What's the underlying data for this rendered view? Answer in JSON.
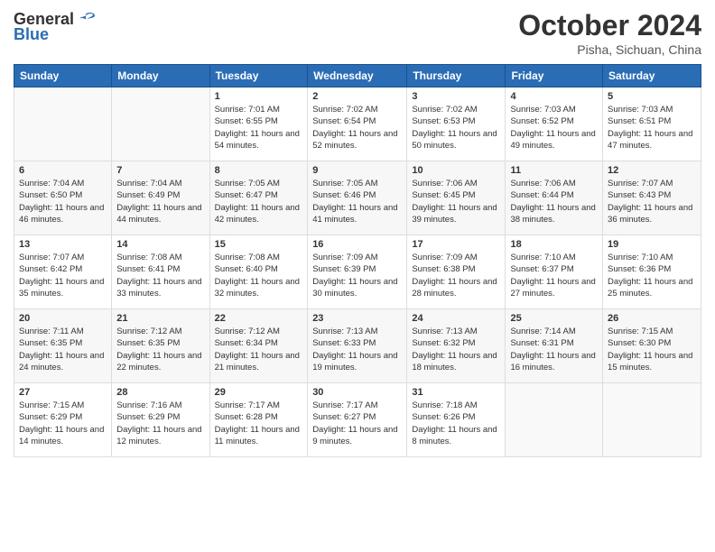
{
  "header": {
    "logo_general": "General",
    "logo_blue": "Blue",
    "month_title": "October 2024",
    "location": "Pisha, Sichuan, China"
  },
  "weekdays": [
    "Sunday",
    "Monday",
    "Tuesday",
    "Wednesday",
    "Thursday",
    "Friday",
    "Saturday"
  ],
  "weeks": [
    [
      {
        "day": "",
        "sunrise": "",
        "sunset": "",
        "daylight": ""
      },
      {
        "day": "",
        "sunrise": "",
        "sunset": "",
        "daylight": ""
      },
      {
        "day": "1",
        "sunrise": "Sunrise: 7:01 AM",
        "sunset": "Sunset: 6:55 PM",
        "daylight": "Daylight: 11 hours and 54 minutes."
      },
      {
        "day": "2",
        "sunrise": "Sunrise: 7:02 AM",
        "sunset": "Sunset: 6:54 PM",
        "daylight": "Daylight: 11 hours and 52 minutes."
      },
      {
        "day": "3",
        "sunrise": "Sunrise: 7:02 AM",
        "sunset": "Sunset: 6:53 PM",
        "daylight": "Daylight: 11 hours and 50 minutes."
      },
      {
        "day": "4",
        "sunrise": "Sunrise: 7:03 AM",
        "sunset": "Sunset: 6:52 PM",
        "daylight": "Daylight: 11 hours and 49 minutes."
      },
      {
        "day": "5",
        "sunrise": "Sunrise: 7:03 AM",
        "sunset": "Sunset: 6:51 PM",
        "daylight": "Daylight: 11 hours and 47 minutes."
      }
    ],
    [
      {
        "day": "6",
        "sunrise": "Sunrise: 7:04 AM",
        "sunset": "Sunset: 6:50 PM",
        "daylight": "Daylight: 11 hours and 46 minutes."
      },
      {
        "day": "7",
        "sunrise": "Sunrise: 7:04 AM",
        "sunset": "Sunset: 6:49 PM",
        "daylight": "Daylight: 11 hours and 44 minutes."
      },
      {
        "day": "8",
        "sunrise": "Sunrise: 7:05 AM",
        "sunset": "Sunset: 6:47 PM",
        "daylight": "Daylight: 11 hours and 42 minutes."
      },
      {
        "day": "9",
        "sunrise": "Sunrise: 7:05 AM",
        "sunset": "Sunset: 6:46 PM",
        "daylight": "Daylight: 11 hours and 41 minutes."
      },
      {
        "day": "10",
        "sunrise": "Sunrise: 7:06 AM",
        "sunset": "Sunset: 6:45 PM",
        "daylight": "Daylight: 11 hours and 39 minutes."
      },
      {
        "day": "11",
        "sunrise": "Sunrise: 7:06 AM",
        "sunset": "Sunset: 6:44 PM",
        "daylight": "Daylight: 11 hours and 38 minutes."
      },
      {
        "day": "12",
        "sunrise": "Sunrise: 7:07 AM",
        "sunset": "Sunset: 6:43 PM",
        "daylight": "Daylight: 11 hours and 36 minutes."
      }
    ],
    [
      {
        "day": "13",
        "sunrise": "Sunrise: 7:07 AM",
        "sunset": "Sunset: 6:42 PM",
        "daylight": "Daylight: 11 hours and 35 minutes."
      },
      {
        "day": "14",
        "sunrise": "Sunrise: 7:08 AM",
        "sunset": "Sunset: 6:41 PM",
        "daylight": "Daylight: 11 hours and 33 minutes."
      },
      {
        "day": "15",
        "sunrise": "Sunrise: 7:08 AM",
        "sunset": "Sunset: 6:40 PM",
        "daylight": "Daylight: 11 hours and 32 minutes."
      },
      {
        "day": "16",
        "sunrise": "Sunrise: 7:09 AM",
        "sunset": "Sunset: 6:39 PM",
        "daylight": "Daylight: 11 hours and 30 minutes."
      },
      {
        "day": "17",
        "sunrise": "Sunrise: 7:09 AM",
        "sunset": "Sunset: 6:38 PM",
        "daylight": "Daylight: 11 hours and 28 minutes."
      },
      {
        "day": "18",
        "sunrise": "Sunrise: 7:10 AM",
        "sunset": "Sunset: 6:37 PM",
        "daylight": "Daylight: 11 hours and 27 minutes."
      },
      {
        "day": "19",
        "sunrise": "Sunrise: 7:10 AM",
        "sunset": "Sunset: 6:36 PM",
        "daylight": "Daylight: 11 hours and 25 minutes."
      }
    ],
    [
      {
        "day": "20",
        "sunrise": "Sunrise: 7:11 AM",
        "sunset": "Sunset: 6:35 PM",
        "daylight": "Daylight: 11 hours and 24 minutes."
      },
      {
        "day": "21",
        "sunrise": "Sunrise: 7:12 AM",
        "sunset": "Sunset: 6:35 PM",
        "daylight": "Daylight: 11 hours and 22 minutes."
      },
      {
        "day": "22",
        "sunrise": "Sunrise: 7:12 AM",
        "sunset": "Sunset: 6:34 PM",
        "daylight": "Daylight: 11 hours and 21 minutes."
      },
      {
        "day": "23",
        "sunrise": "Sunrise: 7:13 AM",
        "sunset": "Sunset: 6:33 PM",
        "daylight": "Daylight: 11 hours and 19 minutes."
      },
      {
        "day": "24",
        "sunrise": "Sunrise: 7:13 AM",
        "sunset": "Sunset: 6:32 PM",
        "daylight": "Daylight: 11 hours and 18 minutes."
      },
      {
        "day": "25",
        "sunrise": "Sunrise: 7:14 AM",
        "sunset": "Sunset: 6:31 PM",
        "daylight": "Daylight: 11 hours and 16 minutes."
      },
      {
        "day": "26",
        "sunrise": "Sunrise: 7:15 AM",
        "sunset": "Sunset: 6:30 PM",
        "daylight": "Daylight: 11 hours and 15 minutes."
      }
    ],
    [
      {
        "day": "27",
        "sunrise": "Sunrise: 7:15 AM",
        "sunset": "Sunset: 6:29 PM",
        "daylight": "Daylight: 11 hours and 14 minutes."
      },
      {
        "day": "28",
        "sunrise": "Sunrise: 7:16 AM",
        "sunset": "Sunset: 6:29 PM",
        "daylight": "Daylight: 11 hours and 12 minutes."
      },
      {
        "day": "29",
        "sunrise": "Sunrise: 7:17 AM",
        "sunset": "Sunset: 6:28 PM",
        "daylight": "Daylight: 11 hours and 11 minutes."
      },
      {
        "day": "30",
        "sunrise": "Sunrise: 7:17 AM",
        "sunset": "Sunset: 6:27 PM",
        "daylight": "Daylight: 11 hours and 9 minutes."
      },
      {
        "day": "31",
        "sunrise": "Sunrise: 7:18 AM",
        "sunset": "Sunset: 6:26 PM",
        "daylight": "Daylight: 11 hours and 8 minutes."
      },
      {
        "day": "",
        "sunrise": "",
        "sunset": "",
        "daylight": ""
      },
      {
        "day": "",
        "sunrise": "",
        "sunset": "",
        "daylight": ""
      }
    ]
  ]
}
